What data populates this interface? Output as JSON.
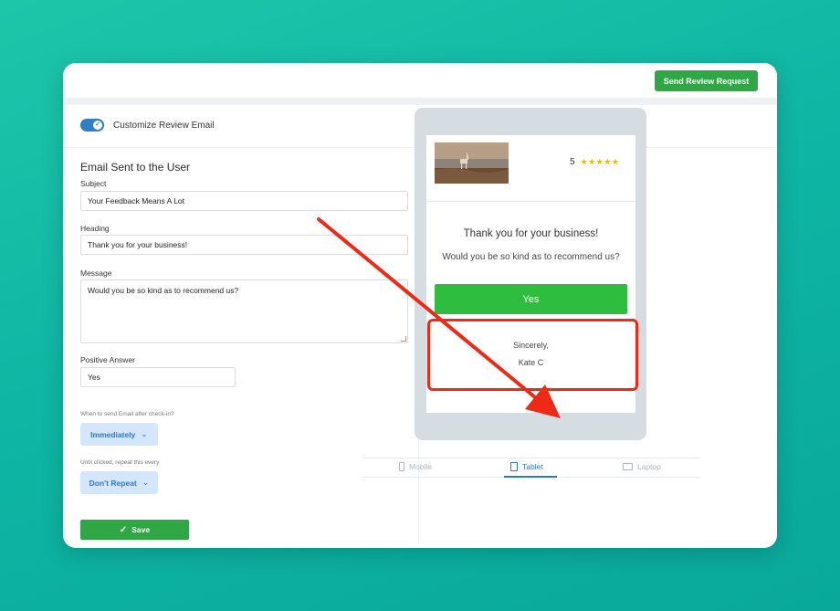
{
  "header": {
    "send_button": "Send Review Request"
  },
  "toggle": {
    "label": "Customize Review Email",
    "state": "on"
  },
  "form": {
    "title": "Email Sent to the User",
    "subject_label": "Subject",
    "subject_value": "Your Feedback Means A Lot",
    "heading_label": "Heading",
    "heading_value": "Thank you for your business!",
    "message_label": "Message",
    "message_value": "Would you be so kind as to recommend us?",
    "positive_label": "Positive Answer",
    "positive_value": "Yes",
    "when_label": "When to send Email after check-in?",
    "when_value": "Immediately",
    "repeat_label": "Until clicked, repeat this every",
    "repeat_value": "Don't Repeat",
    "save_label": "Save"
  },
  "preview": {
    "rating_value": "5",
    "stars": "★★★★★",
    "heading": "Thank you for your business!",
    "message": "Would you be so kind as to recommend us?",
    "yes_button": "Yes",
    "closing": "Sincerely,",
    "signature": "Kate C",
    "tabs": [
      {
        "label": "Mobile",
        "active": false
      },
      {
        "label": "Tablet",
        "active": true
      },
      {
        "label": "Laptop",
        "active": false
      }
    ]
  },
  "colors": {
    "background": "#12b8a5",
    "primary_green": "#2ea744",
    "yes_green": "#2ebd3e",
    "accent_blue": "#2c77d3",
    "annotation_red": "#ee2a17",
    "star": "#f6b400"
  }
}
